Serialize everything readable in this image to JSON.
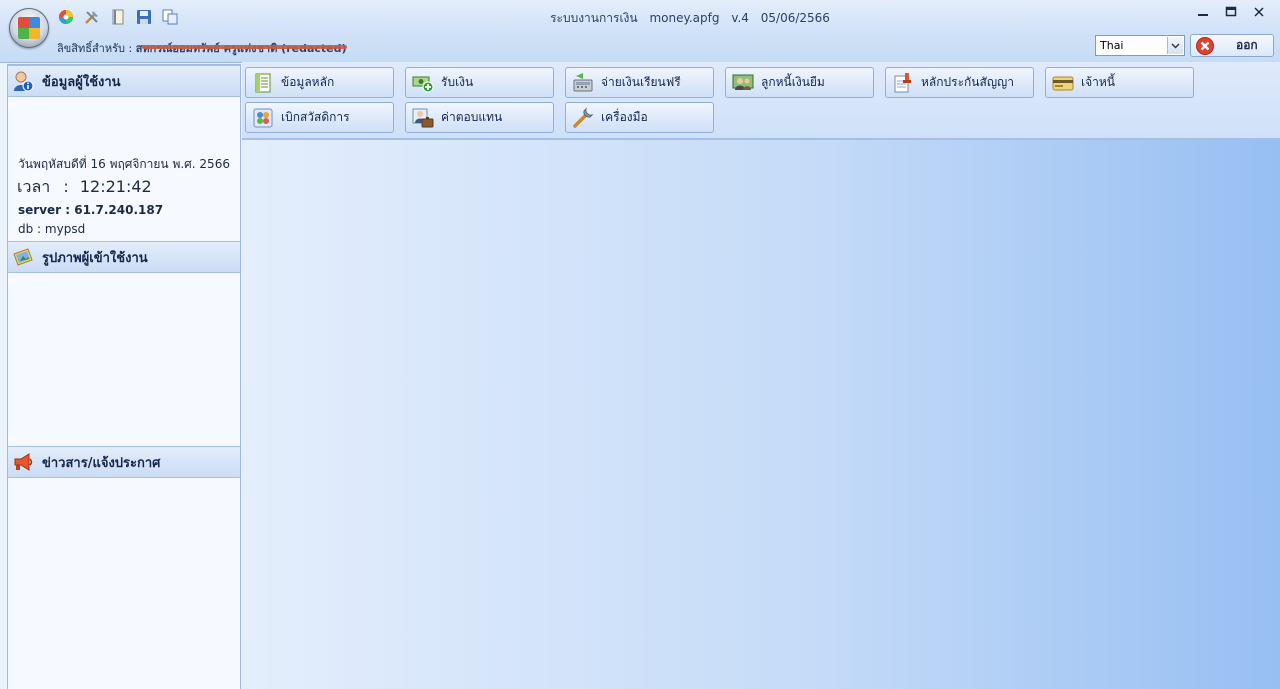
{
  "window": {
    "app_title": "ระบบงานการเงิน",
    "file_name": "money.apfg",
    "version": "v.4",
    "version_date": "05/06/2566",
    "license_label": "ลิขสิทธิ์สำหรับ :",
    "license_name": "สหกรณ์ออมทรัพย์ ครูแห่งชาติ (redacted)"
  },
  "quick_access": [
    {
      "icon": "color-wheel-icon"
    },
    {
      "icon": "tools-icon"
    },
    {
      "icon": "notebook-icon"
    },
    {
      "icon": "save-icon"
    },
    {
      "icon": "copy-icon"
    }
  ],
  "window_controls": {
    "minimize": "—",
    "maximize": "▢",
    "close": "✕"
  },
  "language": {
    "selected": "Thai"
  },
  "exit_button": {
    "label": "ออก"
  },
  "left_panel": {
    "user_info_title": "ข้อมูลผู้ใช้งาน",
    "date_text": "วันพฤหัสบดีที่ 16 พฤศจิกายน พ.ศ. 2566",
    "time_label": "เวลา",
    "time_value": "12:21:42",
    "server_text": "server : 61.7.240.187",
    "db_text": "db : mypsd",
    "user_photo_title": "รูปภาพผู้เข้าใช้งาน",
    "news_title": "ข่าวสาร/แจ้งประกาศ"
  },
  "toolbar": {
    "buttons": [
      {
        "label": "ข้อมูลหลัก",
        "icon": "data-sheet-icon"
      },
      {
        "label": "รับเงิน",
        "icon": "receive-money-icon"
      },
      {
        "label": "จ่ายเงินเรียนฟรี",
        "icon": "cash-register-icon"
      },
      {
        "label": "ลูกหนี้เงินยืม",
        "icon": "debtor-icon"
      },
      {
        "label": "หลักประกันสัญญา",
        "icon": "contract-stamp-icon"
      },
      {
        "label": "เจ้าหนี้",
        "icon": "credit-card-icon"
      },
      {
        "label": "เบิกสวัสดิการ",
        "icon": "welfare-icon"
      },
      {
        "label": "ค่าตอบแทน",
        "icon": "compensation-icon"
      },
      {
        "label": "เครื่องมือ",
        "icon": "wrench-icon"
      }
    ]
  }
}
